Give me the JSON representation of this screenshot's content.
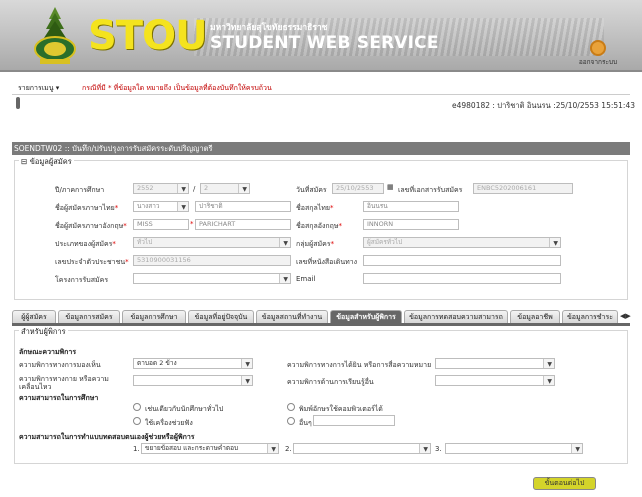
{
  "header": {
    "brand": "STOU",
    "university_th": "มหาวิทยาลัยสุโขทัยธรรมาธิราช",
    "service": "STUDENT WEB SERVICE",
    "logout_label": "ออกจากระบบ"
  },
  "menubar": {
    "menu_label": "รายการเมนู",
    "notice": "กรณีที่มี * ที่ข้อมูลใด หมายถึง เป็นข้อมูลที่ต้องบันทึกให้ครบถ้วน"
  },
  "user_info": "e4980182 : ปาริชาติ อินนรน :25/10/2553 15:51:43",
  "title_bar": "SOENDTW02 :: บันทึก/ปรับปรุงการรับสมัครระดับปริญญาตรี",
  "applicant": {
    "legend": "ข้อมูลผู้สมัคร",
    "year_label": "ปี/ภาคการศึกษา",
    "year_value": "2552",
    "term_value": "2",
    "apply_date_label": "วันที่สมัคร",
    "apply_date_value": "25/10/2553",
    "doc_no_label": "เลขที่เอกสารรับสมัคร",
    "doc_no_value": "ENBC5202006161",
    "name_th_label": "ชื่อผู้สมัครภาษาไทย",
    "prefix_th_value": "นางสาว",
    "name_th_value": "ปาริชาติ",
    "surname_th_label": "ชื่อสกุลไทย",
    "surname_th_value": "อินนรน",
    "name_en_label": "ชื่อผู้สมัครภาษาอังกฤษ",
    "prefix_en_value": "MISS",
    "name_en_value": "PARICHART",
    "surname_en_label": "ชื่อสกุลอังกฤษ",
    "surname_en_value": "INNORN",
    "type_label": "ประเภทของผู้สมัคร",
    "type_value": "ทั่วไป",
    "group_label": "กลุ่มผู้สมัคร",
    "group_value": "ผู้สมัครทั่วไป",
    "idcard_label": "เลขประจำตัวประชาชน",
    "idcard_value": "5310900031156",
    "book_label": "เลขที่หนังสือเดินทาง",
    "project_label": "โครงการรับสมัคร",
    "email_label": "Email"
  },
  "tabs": [
    {
      "label": "ผู้ผู้สมัคร"
    },
    {
      "label": "ข้อมูลการสมัคร"
    },
    {
      "label": "ข้อมูลการศึกษา"
    },
    {
      "label": "ข้อมูลที่อยู่ปัจจุบัน"
    },
    {
      "label": "ข้อมูลสถานที่ทำงาน"
    },
    {
      "label": "ข้อมูลสำหรับผู้พิการ"
    },
    {
      "label": "ข้อมูลการทดสอบความสามารถ"
    },
    {
      "label": "ข้อมูลอาชีพ"
    },
    {
      "label": "ข้อมูลการชำระ"
    }
  ],
  "disabled": {
    "legend": "สำหรับผู้พิการ",
    "nature_header": "ลักษณะความพิการ",
    "see_label": "ความพิการทางการมองเห็น",
    "see_value": "ตาบอด 2 ข้าง",
    "hear_label": "ความพิการทางการได้ยิน หรือการสื่อความหมาย",
    "body_label": "ความพิการทางกาย หรือความเคลื่อนไหว",
    "learn_label": "ความพิการด้านการเรียนรู้อื่น",
    "study_header": "ความสามารถในการศึกษา",
    "opt1": "เช่นเดียวกับนักศึกษาทั่วไป",
    "opt2": "พิมพ์อักษรใช้คอมพิวเตอร์ได้",
    "opt3": "ใช้เครื่องช่วยฟัง",
    "opt4": "อื่นๆ",
    "exam_header": "ความสามารถในการทำแบบทดสอบตนเองผู้ช่วยหรือผู้พิการ",
    "exam1_no": "1.",
    "exam1_value": "ขยายข้อสอบ และกระดาษคำตอบ",
    "exam2_no": "2.",
    "exam3_no": "3."
  },
  "next_button": "ขั้นตอนต่อไป"
}
